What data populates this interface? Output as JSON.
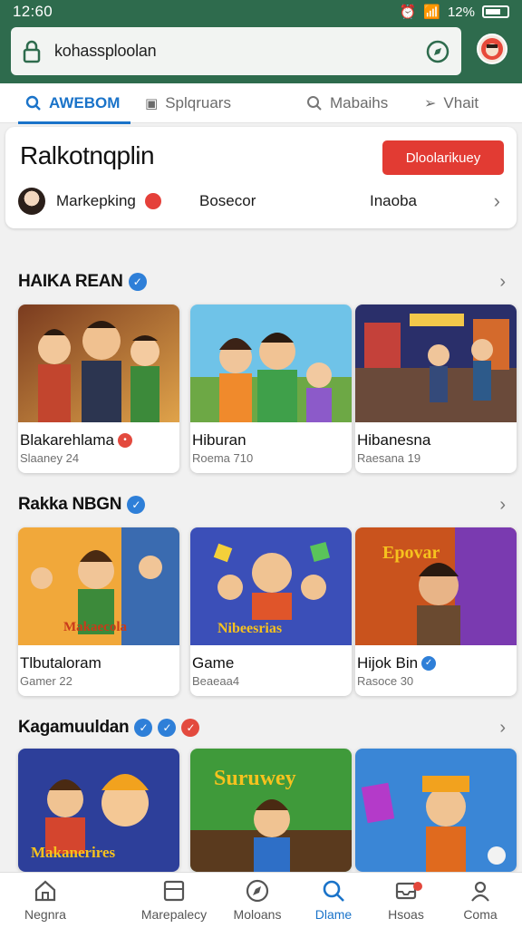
{
  "status": {
    "time": "12:60",
    "battery": "12%"
  },
  "browser": {
    "url": "kohassploolan"
  },
  "tabs": [
    {
      "label": "AWEBOM",
      "active": true
    },
    {
      "label": "Splqruars",
      "active": false
    },
    {
      "label": "Mabaihs",
      "active": false
    },
    {
      "label": "Vhait",
      "active": false
    }
  ],
  "profile": {
    "name": "Ralkotnqplin",
    "cta": "Dloolarikuey",
    "meta": [
      "Markepking",
      "Bosecor",
      "Inaoba"
    ]
  },
  "sections": [
    {
      "title": "HAIKA REAN",
      "cards": [
        {
          "title": "Blakarehlama",
          "subtitle": "Slaaney 24"
        },
        {
          "title": "Hiburan",
          "subtitle": "Roema 710"
        },
        {
          "title": "Hibanesna",
          "subtitle": "Raesana 19"
        }
      ]
    },
    {
      "title": "Rakka NBGN",
      "cards": [
        {
          "title": "Tlbutaloram",
          "subtitle": "Gamer 22",
          "art_text": "Makaecola"
        },
        {
          "title": "Game",
          "subtitle": "Beaeaa4",
          "art_text": "Nibeesrias"
        },
        {
          "title": "Hijok Bin",
          "subtitle": "Rasoce 30",
          "art_text": "Epovar"
        }
      ]
    },
    {
      "title": "Kagamuuldan",
      "cards": [
        {
          "art_text": "Makanerires"
        },
        {
          "art_text": "Suruwey"
        },
        {
          "art_text": ""
        }
      ]
    }
  ],
  "bottom_nav": [
    {
      "label": "Negnra",
      "icon": "home-icon"
    },
    {
      "label": "Marepalecy",
      "icon": "store-icon"
    },
    {
      "label": "Moloans",
      "icon": "compass-icon"
    },
    {
      "label": "Dlame",
      "icon": "search-icon",
      "active": true
    },
    {
      "label": "Hsoas",
      "icon": "inbox-icon"
    },
    {
      "label": "Coma",
      "icon": "profile-icon"
    }
  ],
  "colors": {
    "header": "#2e6b4d",
    "accent": "#1a73c9",
    "cta": "#e23b33"
  }
}
